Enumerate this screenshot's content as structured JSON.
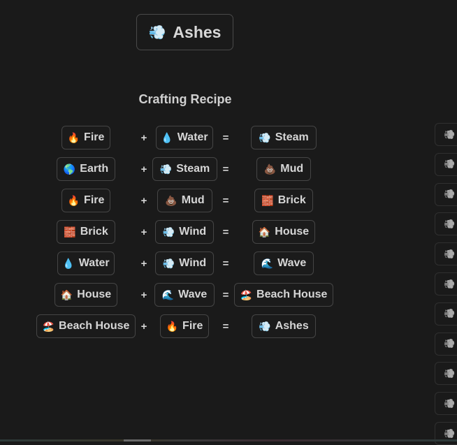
{
  "target": {
    "icon": "dashing-away-icon",
    "emoji": "💨",
    "label": "Ashes"
  },
  "heading": "Crafting Recipe",
  "operators": {
    "plus": "+",
    "equals": "="
  },
  "recipes": [
    {
      "a": {
        "emoji": "🔥",
        "label": "Fire"
      },
      "b": {
        "emoji": "💧",
        "label": "Water"
      },
      "result": {
        "emoji": "💨",
        "label": "Steam"
      }
    },
    {
      "a": {
        "emoji": "🌎",
        "label": "Earth"
      },
      "b": {
        "emoji": "💨",
        "label": "Steam"
      },
      "result": {
        "emoji": "💩",
        "label": "Mud"
      }
    },
    {
      "a": {
        "emoji": "🔥",
        "label": "Fire"
      },
      "b": {
        "emoji": "💩",
        "label": "Mud"
      },
      "result": {
        "emoji": "🧱",
        "label": "Brick"
      }
    },
    {
      "a": {
        "emoji": "🧱",
        "label": "Brick"
      },
      "b": {
        "emoji": "💨",
        "label": "Wind"
      },
      "result": {
        "emoji": "🏠",
        "label": "House"
      }
    },
    {
      "a": {
        "emoji": "💧",
        "label": "Water"
      },
      "b": {
        "emoji": "💨",
        "label": "Wind"
      },
      "result": {
        "emoji": "🌊",
        "label": "Wave"
      }
    },
    {
      "a": {
        "emoji": "🏠",
        "label": "House"
      },
      "b": {
        "emoji": "🌊",
        "label": "Wave"
      },
      "result": {
        "emoji": "🏖️",
        "label": "Beach House"
      }
    },
    {
      "a": {
        "emoji": "🏖️",
        "label": "Beach House"
      },
      "b": {
        "emoji": "🔥",
        "label": "Fire"
      },
      "result": {
        "emoji": "💨",
        "label": "Ashes"
      }
    }
  ],
  "sidebar": {
    "items": [
      {
        "emoji": "💨"
      },
      {
        "emoji": "💨"
      },
      {
        "emoji": "💨"
      },
      {
        "emoji": "💨"
      },
      {
        "emoji": "💨"
      },
      {
        "emoji": "💨"
      },
      {
        "emoji": "💨"
      },
      {
        "emoji": "💨"
      },
      {
        "emoji": "💨"
      },
      {
        "emoji": "💨"
      },
      {
        "emoji": "💨"
      }
    ]
  }
}
